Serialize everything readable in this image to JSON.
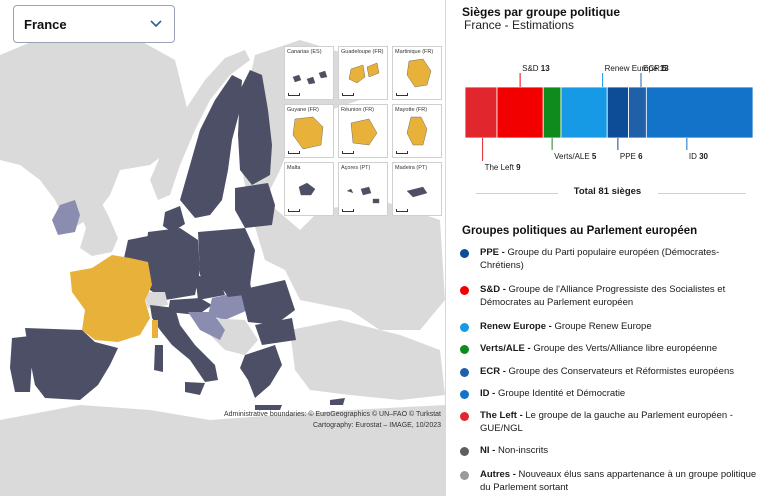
{
  "selector": {
    "value": "France"
  },
  "map": {
    "insets": [
      "Canarias (ES)",
      "Guadeloupe (FR)",
      "Martinique (FR)",
      "Guyane (FR)",
      "Réunion (FR)",
      "Mayotte (FR)",
      "Malta",
      "Açores (PT)",
      "Madeira (PT)"
    ],
    "credits_line1": "Administrative boundaries: © EuroGeographics © UN–FAO © Turkstat",
    "credits_line2": "Cartography: Eurostat – IMAGE, 10/2023",
    "colors": {
      "highlight": "#e8b23a",
      "member": "#4d4f66",
      "other": "#dadada",
      "sea": "#ffffff",
      "partial": "#8a8db0"
    }
  },
  "chart_data": {
    "type": "bar",
    "title": "Sièges par groupe politique",
    "subtitle": "France - Estimations",
    "orientation": "stacked-horizontal",
    "series": [
      {
        "name": "The Left",
        "value": 9,
        "color": "#e2262d"
      },
      {
        "name": "S&D",
        "value": 13,
        "color": "#f20000"
      },
      {
        "name": "Verts/ALE",
        "value": 5,
        "color": "#0f8a1c"
      },
      {
        "name": "Renew Europe",
        "value": 13,
        "color": "#179ae6"
      },
      {
        "name": "PPE",
        "value": 6,
        "color": "#0d4c96"
      },
      {
        "name": "ECR",
        "value": 5,
        "color": "#1f60a8"
      },
      {
        "name": "ID",
        "value": 30,
        "color": "#1273c9"
      }
    ],
    "total_label": "Total 81 sièges"
  },
  "legend": {
    "title": "Groupes politiques au Parlement européen",
    "items": [
      {
        "abbr": "PPE - ",
        "desc": "Groupe du Parti populaire européen (Démocrates-Chrétiens)",
        "color": "#0d4c96"
      },
      {
        "abbr": "S&D - ",
        "desc": "Groupe de l'Alliance Progressiste des Socialistes et Démocrates au Parlement européen",
        "color": "#f20000"
      },
      {
        "abbr": "Renew Europe - ",
        "desc": "Groupe Renew Europe",
        "color": "#179ae6"
      },
      {
        "abbr": "Verts/ALE - ",
        "desc": "Groupe des Verts/Alliance libre européenne",
        "color": "#0f8a1c"
      },
      {
        "abbr": "ECR - ",
        "desc": "Groupe des Conservateurs et Réformistes européens",
        "color": "#1f60a8"
      },
      {
        "abbr": "ID - ",
        "desc": "Groupe Identité et Démocratie",
        "color": "#1273c9"
      },
      {
        "abbr": "The Left - ",
        "desc": "Le groupe de la gauche au Parlement européen - GUE/NGL",
        "color": "#e2262d"
      },
      {
        "abbr": "NI - ",
        "desc": "Non-inscrits",
        "color": "#5e5e5e"
      },
      {
        "abbr": "Autres - ",
        "desc": "Nouveaux élus sans appartenance à un groupe politique du Parlement sortant",
        "color": "#9a9a9a"
      }
    ]
  }
}
